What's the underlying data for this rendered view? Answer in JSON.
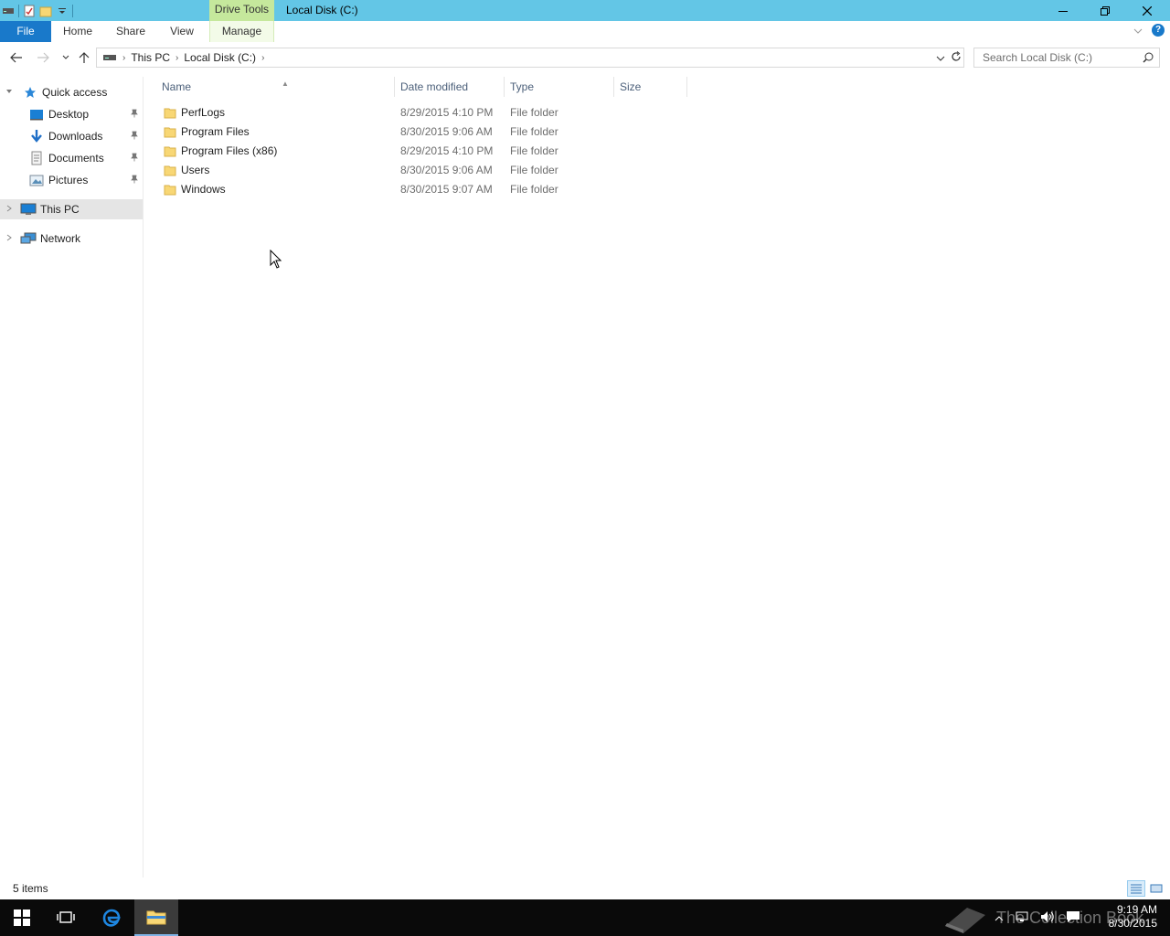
{
  "window": {
    "title": "Local Disk (C:)",
    "contextual_tab": "Drive Tools",
    "accent": "#63c6e6"
  },
  "ribbon": {
    "tabs": [
      {
        "label": "File"
      },
      {
        "label": "Home"
      },
      {
        "label": "Share"
      },
      {
        "label": "View"
      },
      {
        "label": "Manage"
      }
    ]
  },
  "address": {
    "breadcrumbs": [
      "This PC",
      "Local Disk (C:)"
    ],
    "search_placeholder": "Search Local Disk (C:)"
  },
  "navigation": {
    "quick_access": "Quick access",
    "pinned": [
      {
        "label": "Desktop",
        "icon": "desktop-icon"
      },
      {
        "label": "Downloads",
        "icon": "download-icon"
      },
      {
        "label": "Documents",
        "icon": "documents-icon"
      },
      {
        "label": "Pictures",
        "icon": "pictures-icon"
      }
    ],
    "this_pc": "This PC",
    "network": "Network"
  },
  "columns": {
    "name": "Name",
    "date": "Date modified",
    "type": "Type",
    "size": "Size"
  },
  "files": [
    {
      "name": "PerfLogs",
      "date": "8/29/2015 4:10 PM",
      "type": "File folder"
    },
    {
      "name": "Program Files",
      "date": "8/30/2015 9:06 AM",
      "type": "File folder"
    },
    {
      "name": "Program Files (x86)",
      "date": "8/29/2015 4:10 PM",
      "type": "File folder"
    },
    {
      "name": "Users",
      "date": "8/30/2015 9:06 AM",
      "type": "File folder"
    },
    {
      "name": "Windows",
      "date": "8/30/2015 9:07 AM",
      "type": "File folder"
    }
  ],
  "status": {
    "item_count": "5 items"
  },
  "taskbar": {
    "time": "9:19 AM",
    "date": "8/30/2015",
    "watermark": "The Collection Book"
  }
}
